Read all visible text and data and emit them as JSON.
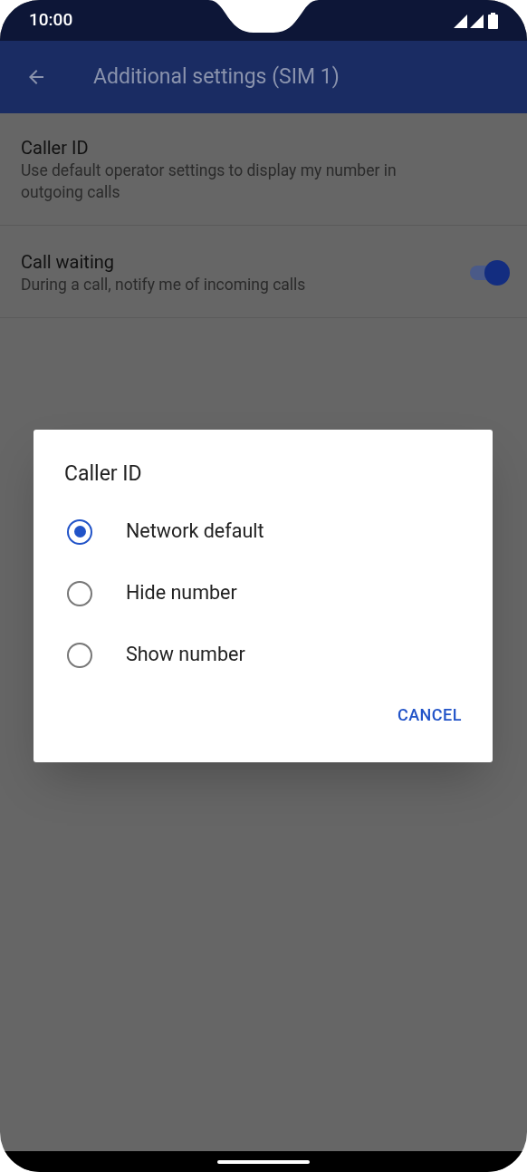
{
  "status_bar": {
    "time": "10:00"
  },
  "app_bar": {
    "title": "Additional settings (SIM 1)"
  },
  "settings": [
    {
      "kind": "text",
      "title": "Caller ID",
      "summary": "Use default operator settings to display my number in outgoing calls"
    },
    {
      "kind": "switch",
      "title": "Call waiting",
      "summary": "During a call, notify me of incoming calls",
      "on": true
    }
  ],
  "dialog": {
    "title": "Caller ID",
    "options": [
      {
        "label": "Network default",
        "selected": true
      },
      {
        "label": "Hide number",
        "selected": false
      },
      {
        "label": "Show number",
        "selected": false
      }
    ],
    "buttons": [
      "CANCEL"
    ]
  }
}
